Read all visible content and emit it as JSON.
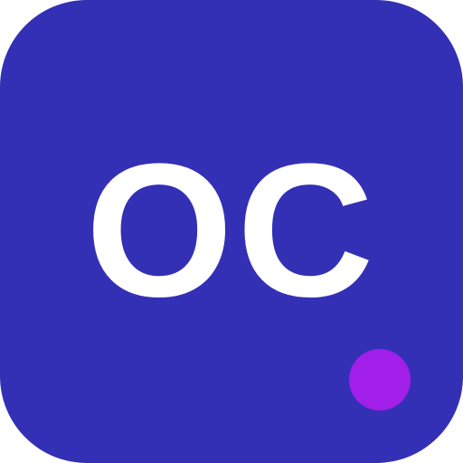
{
  "icon": {
    "monogram": "OC",
    "background_color": "#3330b6",
    "text_color": "#ffffff",
    "status_dot_color": "#a21fe9"
  }
}
